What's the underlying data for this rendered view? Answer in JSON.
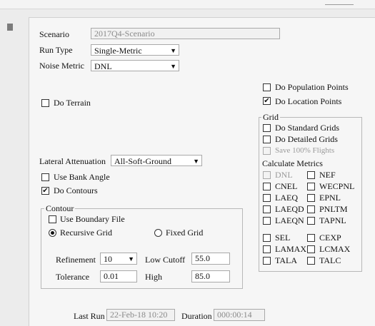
{
  "scenario": {
    "label": "Scenario",
    "value": "2017Q4-Scenario"
  },
  "run_type": {
    "label": "Run Type",
    "value": "Single-Metric"
  },
  "noise_metric": {
    "label": "Noise Metric",
    "value": "DNL"
  },
  "do_terrain": {
    "label": "Do Terrain",
    "checked": false
  },
  "do_population_points": {
    "label": "Do Population Points",
    "checked": false
  },
  "do_location_points": {
    "label": "Do Location Points",
    "checked": true
  },
  "grid": {
    "title": "Grid",
    "standard": {
      "label": "Do Standard Grids",
      "checked": false
    },
    "detailed": {
      "label": "Do Detailed Grids",
      "checked": false
    },
    "save100": {
      "label": "Save 100% Flights",
      "checked": false,
      "disabled": true
    },
    "calc_title": "Calculate Metrics",
    "metrics_left": [
      "DNL",
      "CNEL",
      "LAEQ",
      "LAEQD",
      "LAEQN"
    ],
    "metrics_right": [
      "NEF",
      "WECPNL",
      "EPNL",
      "PNLTM",
      "TAPNL"
    ],
    "metrics_left2": [
      "SEL",
      "LAMAX",
      "TALA"
    ],
    "metrics_right2": [
      "CEXP",
      "LCMAX",
      "TALC"
    ]
  },
  "lateral_attenuation": {
    "label": "Lateral Attenuation",
    "value": "All-Soft-Ground"
  },
  "use_bank_angle": {
    "label": "Use Bank Angle",
    "checked": false
  },
  "do_contours": {
    "label": "Do Contours",
    "checked": true
  },
  "contour": {
    "title": "Contour",
    "use_boundary_file": {
      "label": "Use Boundary File",
      "checked": false
    },
    "recursive_grid": {
      "label": "Recursive Grid",
      "selected": true
    },
    "fixed_grid": {
      "label": "Fixed Grid",
      "selected": false
    },
    "refinement": {
      "label": "Refinement",
      "value": "10"
    },
    "low_cutoff": {
      "label": "Low Cutoff",
      "value": "55.0"
    },
    "tolerance": {
      "label": "Tolerance",
      "value": "0.01"
    },
    "high": {
      "label": "High",
      "value": "85.0"
    }
  },
  "last_run": {
    "label": "Last Run",
    "value": "22-Feb-18 10:20"
  },
  "duration": {
    "label": "Duration",
    "value": "000:00:14"
  },
  "icons": {
    "check": "✔",
    "dropdown": "▼"
  }
}
